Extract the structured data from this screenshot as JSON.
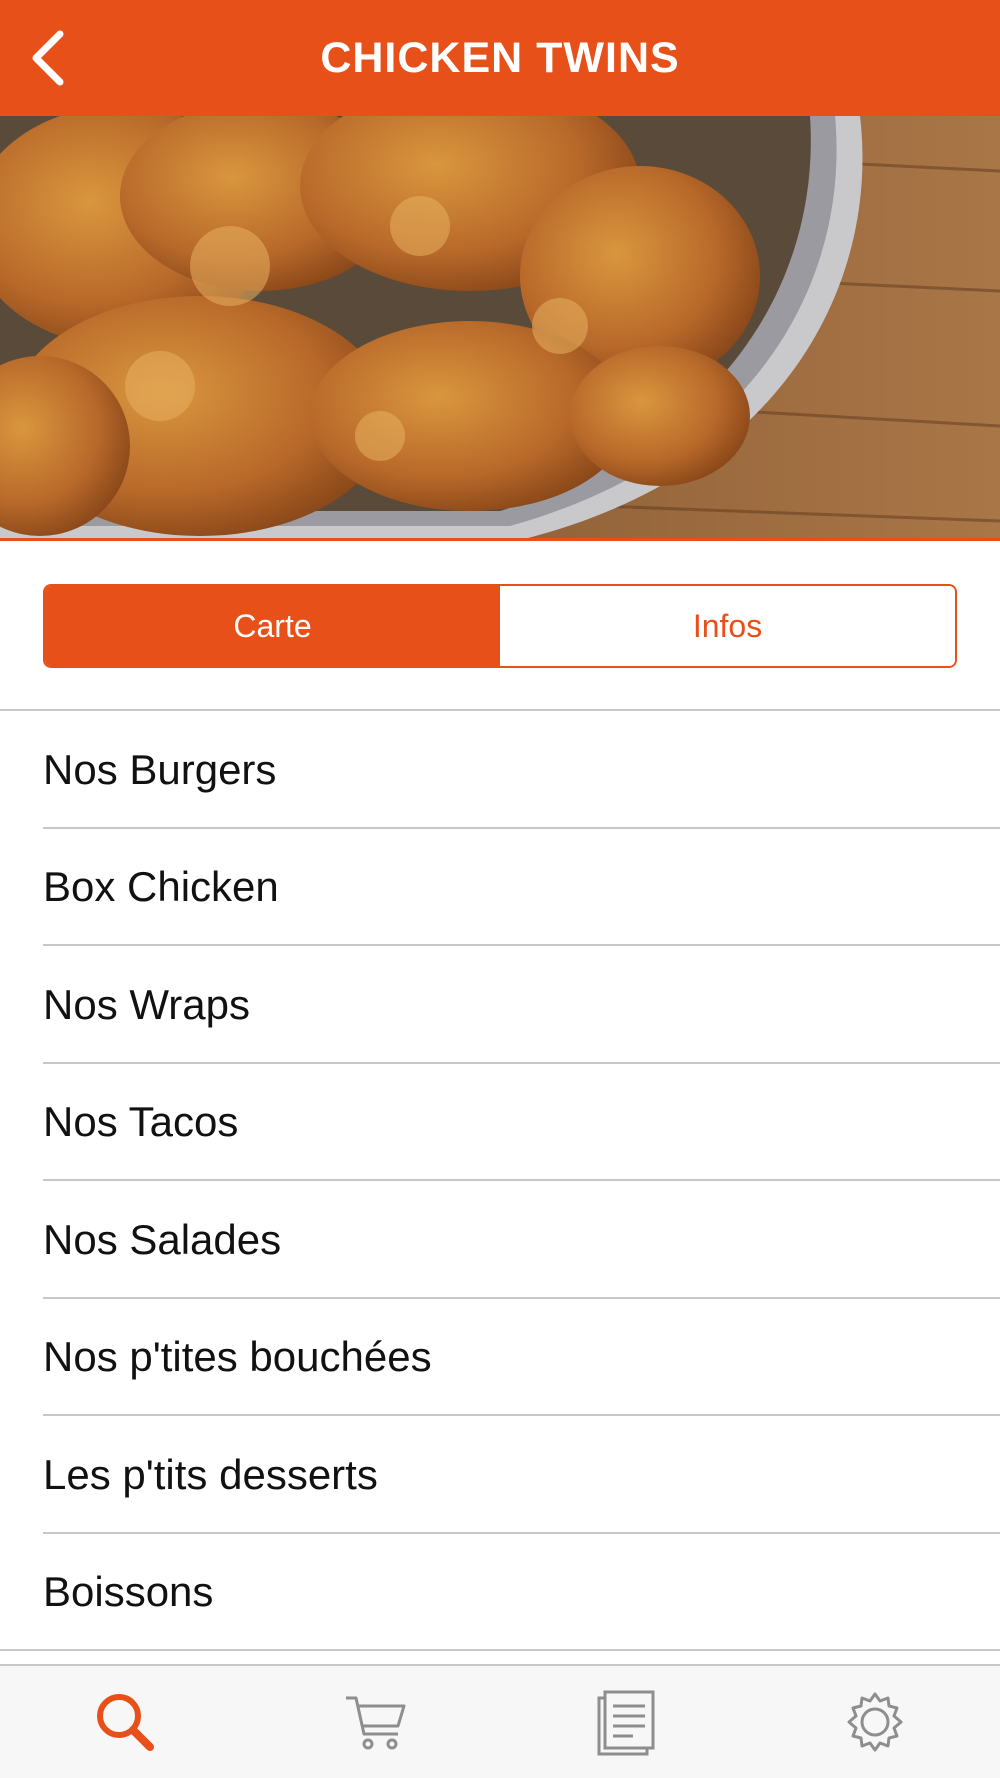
{
  "header": {
    "title": "CHICKEN TWINS",
    "back_icon": "chevron-left-icon"
  },
  "hero": {
    "image": "fried-chicken-bucket-photo"
  },
  "segmented": {
    "carte_label": "Carte",
    "infos_label": "Infos",
    "selected": "Carte"
  },
  "menu": {
    "items": [
      {
        "label": "Nos Burgers"
      },
      {
        "label": "Box Chicken"
      },
      {
        "label": "Nos Wraps"
      },
      {
        "label": "Nos Tacos"
      },
      {
        "label": "Nos Salades"
      },
      {
        "label": "Nos p'tites bouchées"
      },
      {
        "label": "Les p'tits desserts"
      },
      {
        "label": "Boissons"
      }
    ]
  },
  "tabbar": {
    "tabs": [
      {
        "icon": "search-icon",
        "active": true
      },
      {
        "icon": "cart-icon",
        "active": false
      },
      {
        "icon": "document-list-icon",
        "active": false
      },
      {
        "icon": "gear-icon",
        "active": false
      }
    ]
  },
  "colors": {
    "accent": "#e8501a",
    "text": "#111111",
    "divider": "#c8c8c8",
    "tabbar_bg": "#f7f7f7",
    "inactive_icon": "#8e8e8e"
  }
}
